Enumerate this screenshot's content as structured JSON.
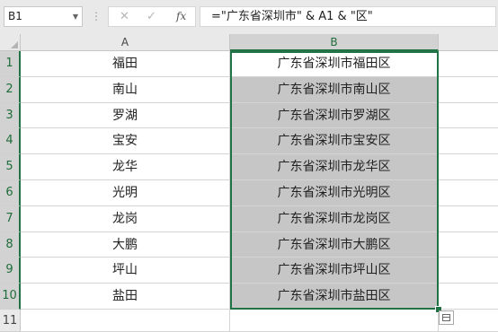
{
  "formula_bar": {
    "name_box": "B1",
    "separator": "⋮",
    "cancel_glyph": "✕",
    "enter_glyph": "✓",
    "fx_label": "fx",
    "formula": "=\"广东省深圳市\" & A1 & \"区\""
  },
  "columns": [
    "A",
    "B"
  ],
  "rows": [
    {
      "num": "1",
      "a": "福田",
      "b": "广东省深圳市福田区"
    },
    {
      "num": "2",
      "a": "南山",
      "b": "广东省深圳市南山区"
    },
    {
      "num": "3",
      "a": "罗湖",
      "b": "广东省深圳市罗湖区"
    },
    {
      "num": "4",
      "a": "宝安",
      "b": "广东省深圳市宝安区"
    },
    {
      "num": "5",
      "a": "龙华",
      "b": "广东省深圳市龙华区"
    },
    {
      "num": "6",
      "a": "光明",
      "b": "广东省深圳市光明区"
    },
    {
      "num": "7",
      "a": "龙岗",
      "b": "广东省深圳市龙岗区"
    },
    {
      "num": "8",
      "a": "大鹏",
      "b": "广东省深圳市大鹏区"
    },
    {
      "num": "9",
      "a": "坪山",
      "b": "广东省深圳市坪山区"
    },
    {
      "num": "10",
      "a": "盐田",
      "b": "广东省深圳市盐田区"
    },
    {
      "num": "11",
      "a": "",
      "b": ""
    }
  ],
  "selection": {
    "active_cell": "B1",
    "range": "B1:B10",
    "accent": "#217346"
  }
}
